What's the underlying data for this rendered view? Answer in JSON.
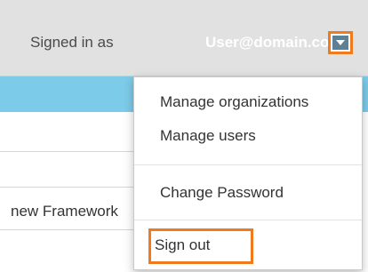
{
  "header": {
    "signed_in_label": "Signed in as",
    "user_email": "User@domain.com",
    "dropdown_icon": "caret-down-icon"
  },
  "table": {
    "visible_cell": "new Framework"
  },
  "menu": {
    "items": [
      {
        "label": "Manage organizations"
      },
      {
        "label": "Manage users"
      },
      {
        "label": "Change Password"
      },
      {
        "label": "Sign out"
      }
    ]
  },
  "colors": {
    "highlight": "#f07b1e",
    "header_band": "#7ccbe8",
    "topbar_bg": "#e1e1e1",
    "caret_bg": "#5e7f94"
  }
}
